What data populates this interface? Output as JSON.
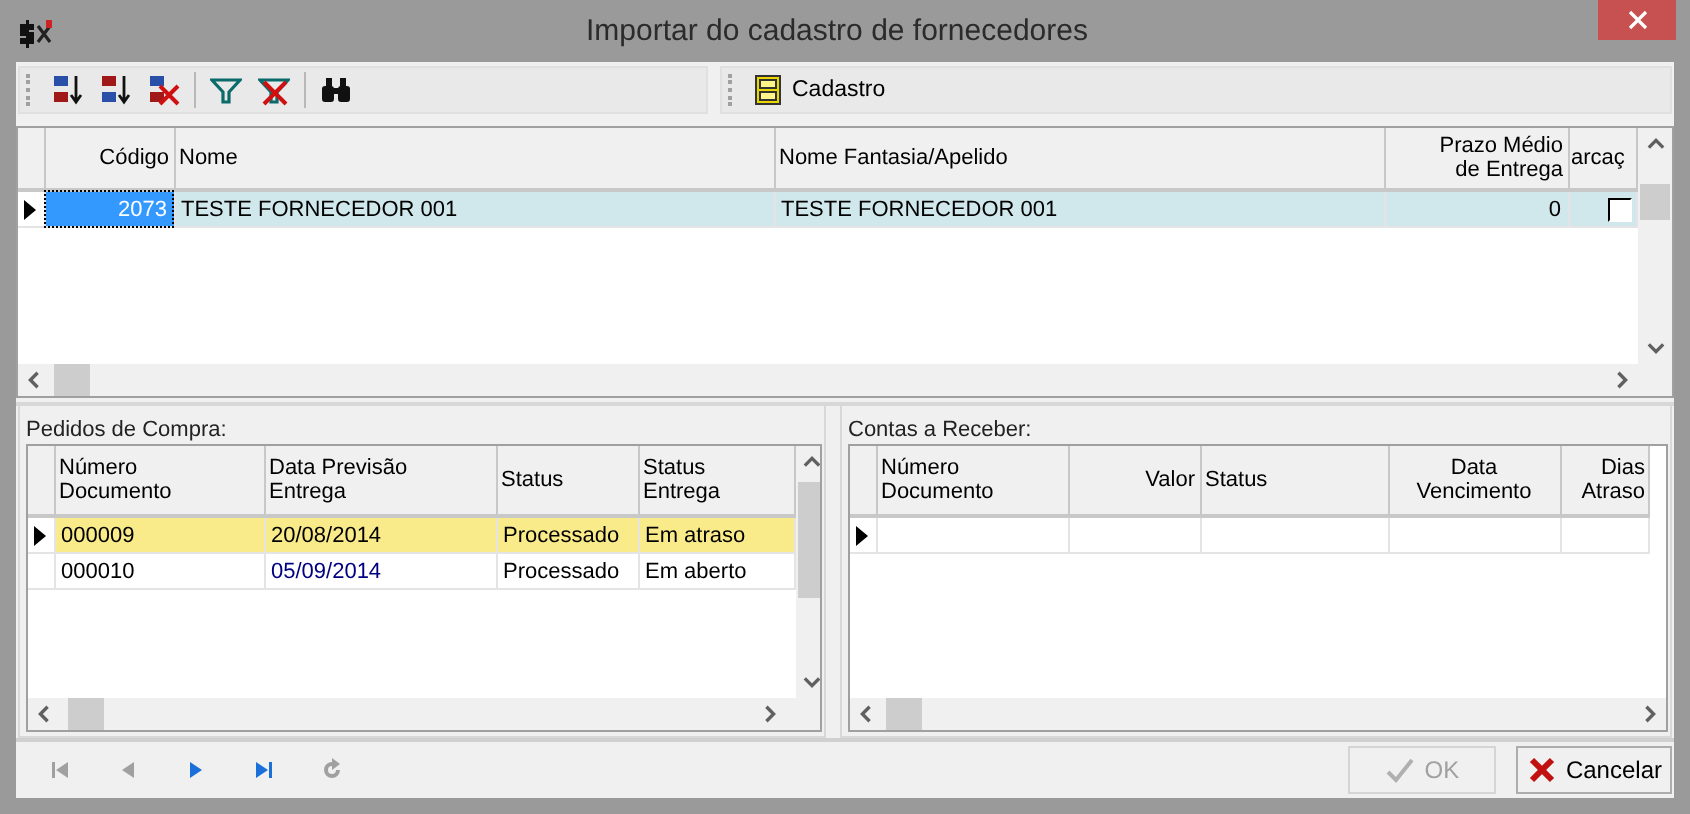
{
  "window": {
    "title": "Importar do cadastro de fornecedores"
  },
  "toolbar": {
    "cadastro_button": {
      "label": "Cadastro"
    }
  },
  "fornecedores_grid": {
    "columns": [
      "Código",
      "Nome",
      "Nome Fantasia/Apelido",
      "Prazo Médio de Entrega",
      "arcaç"
    ],
    "rows": [
      {
        "selected": true,
        "cells": [
          "2073",
          "TESTE FORNECEDOR 001",
          "TESTE FORNECEDOR 001",
          "0"
        ],
        "checked": false
      }
    ]
  },
  "pedidos": {
    "title": "Pedidos de Compra:",
    "columns": [
      "Número Documento",
      "Data Previsão Entrega",
      "Status",
      "Status Entrega"
    ],
    "rows": [
      {
        "selected": true,
        "color": "#000000",
        "cells": [
          "000009",
          "20/08/2014",
          "Processado",
          "Em atraso"
        ]
      },
      {
        "selected": false,
        "color": "#000080",
        "cells": [
          "000010",
          "05/09/2014",
          "Processado",
          "Em aberto"
        ]
      }
    ]
  },
  "contas": {
    "title": "Contas a Receber:",
    "columns": [
      "Número Documento",
      "Valor",
      "Status",
      "Data Vencimento",
      "Dias Atraso"
    ],
    "rows": [
      {
        "selected": true,
        "cells": []
      }
    ]
  },
  "navigator": [
    {
      "disabled": true
    },
    {
      "disabled": true
    },
    {
      "disabled": false
    },
    {
      "disabled": false
    },
    {
      "disabled": true
    }
  ],
  "buttons": [
    {
      "label": "OK",
      "disabled": true
    },
    {
      "label": "Cancelar",
      "disabled": false
    }
  ]
}
